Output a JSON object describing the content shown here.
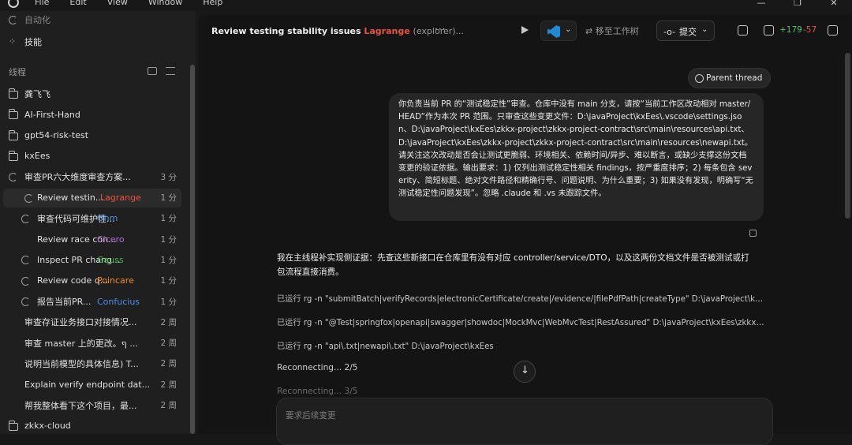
{
  "menu": {
    "items": [
      "File",
      "Edit",
      "View",
      "Window",
      "Help"
    ]
  },
  "sidebar": {
    "top_items": [
      {
        "icon": "automation-icon",
        "label": "自动化"
      },
      {
        "icon": "skills-icon",
        "label": "技能"
      }
    ],
    "section_title": "线程",
    "folders": [
      {
        "label": "龚飞飞"
      },
      {
        "label": "AI-First-Hand"
      },
      {
        "label": "gpt54-risk-test"
      },
      {
        "label": "kxEes"
      }
    ],
    "threads": [
      {
        "label": "审查PR六大维度审查方案...",
        "agent": "",
        "time": "3 分",
        "spinner": true,
        "indent": false
      },
      {
        "label": "Review testin...",
        "agent": "Lagrange",
        "agent_color": "#e8543f",
        "time": "1 分",
        "spinner": true,
        "indent": true,
        "active": true
      },
      {
        "label": "审查代码可维护性...",
        "agent": "Ohm",
        "agent_color": "#4a90e2",
        "time": "1 分",
        "spinner": true,
        "indent": true
      },
      {
        "label": "Review race con...",
        "agent": "Cicero",
        "agent_color": "#b56ad6",
        "time": "1 分",
        "spinner": false,
        "indent": true
      },
      {
        "label": "Inspect PR chang...",
        "agent": "Gauss",
        "agent_color": "#3fb950",
        "time": "1 分",
        "spinner": true,
        "indent": true
      },
      {
        "label": "Review code q...",
        "agent": "Poincare",
        "agent_color": "#f08a24",
        "time": "1 分",
        "spinner": true,
        "indent": true
      },
      {
        "label": "报告当前PR...",
        "agent": "Confucius",
        "agent_color": "#4a90e2",
        "time": "1 分",
        "spinner": true,
        "indent": true
      },
      {
        "label": "审查存证业务接口对接情况...",
        "agent": "",
        "time": "2 周",
        "spinner": false,
        "indent": false
      },
      {
        "label": "审查 master 上的更改。ף ...",
        "agent": "",
        "time": "2 周",
        "spinner": false,
        "indent": false
      },
      {
        "label": "说明当前模型的具体信息) T...",
        "agent": "",
        "time": "2 周",
        "spinner": false,
        "indent": false
      },
      {
        "label": "Explain verify endpoint dat...",
        "agent": "",
        "time": "2 周",
        "spinner": false,
        "indent": false
      },
      {
        "label": "帮我整体看下这个项目，最...",
        "agent": "",
        "time": "2 周",
        "spinner": false,
        "indent": false
      }
    ],
    "bottom_folder": "zkkx-cloud"
  },
  "header": {
    "title": "Review testing stability issues",
    "agent": "Lagrange",
    "agent_sub": "(explorer)...",
    "more": "···",
    "move_label": "移至工作树",
    "commit_label": "提交",
    "diff_add": "+179",
    "diff_del": "-57"
  },
  "thread": {
    "parent_button": "Parent thread",
    "user_message": "你负责当前 PR 的“测试稳定性”审查。仓库中没有 main 分支，请按“当前工作区改动相对 master/HEAD”作为本次 PR 范围。只审查这些变更文件：D:\\javaProject\\kxEes\\.vscode\\settings.json、D:\\javaProject\\kxEes\\zkkx-project\\zkkx-project-contract\\src\\main\\resources\\api.txt、D:\\javaProject\\kxEes\\zkkx-project\\zkkx-project-contract\\src\\main\\resources\\newapi.txt。请关注这次改动是否会让测试更脆弱、环境相关、依赖时间/异步、难以断言，或缺少支撑这份文档变更的验证依据。输出要求：1) 仅列出测试稳定性相关 findings，按严重度排序；2) 每条包含 severity、简短标题、绝对文件路径和精确行号、问题说明、为什么重要；3) 如果没有发现，明确写“无测试稳定性问题发现”。忽略 .claude 和 .vs 未跟踪文件。",
    "assistant_message": "我在主线程补实现侧证据：先查这些新接口在仓库里有没有对应 controller/service/DTO，以及这两份文档文件是否被测试或打包流程直接消费。",
    "commands": [
      {
        "prefix": "已运行",
        "code": "rg -n \"submitBatch|verifyRecords|electronicCertificate/create|/evidence/|filePdfPath|createType\" D:\\javaProject\\kxEes"
      },
      {
        "prefix": "已运行",
        "code": "rg -n \"@Test|springfox|openapi|swagger|showdoc|MockMvc|WebMvcTest|RestAssured\" D:\\javaProject\\kxEes\\zkkx-p..."
      },
      {
        "prefix": "已运行",
        "code": "rg -n \"api\\.txt|newapi\\.txt\" D:\\javaProject\\kxEes"
      }
    ],
    "status_1": "Reconnecting... 2/5",
    "status_2": "Reconnecting... 3/5"
  },
  "composer": {
    "placeholder": "要求后续变更"
  }
}
